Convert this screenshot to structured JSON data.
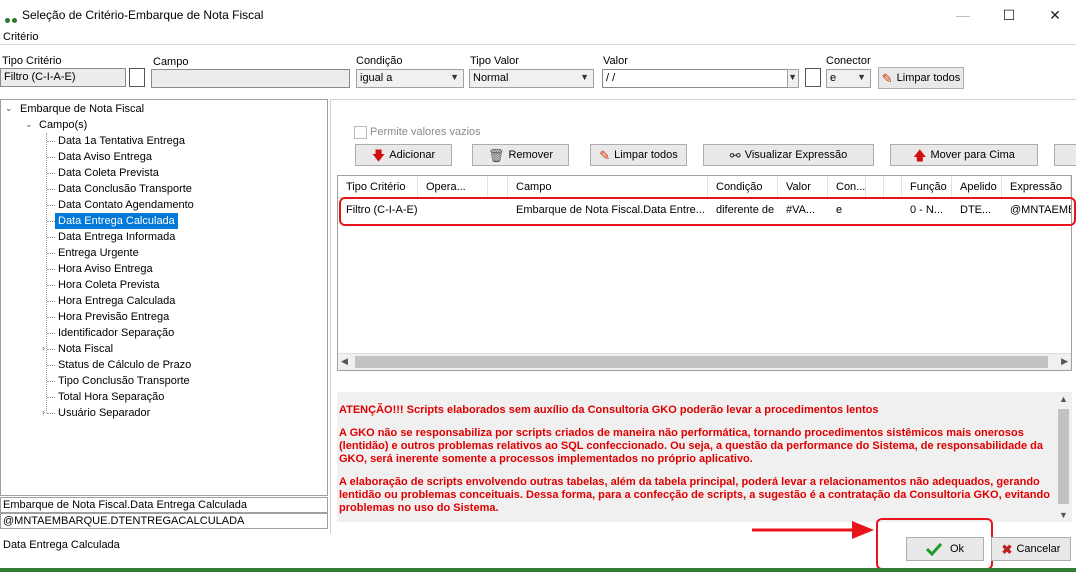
{
  "window": {
    "title": "Seleção de Critério-Embarque de Nota Fiscal",
    "minimize": "—",
    "maximize": "☐",
    "close": "✕"
  },
  "criterio": {
    "group_label": "Critério",
    "tipo_criterio_label": "Tipo Critério",
    "tipo_criterio_value": "Filtro (C-I-A-E)",
    "campo_label": "Campo",
    "campo_value": "",
    "condicao_label": "Condição",
    "condicao_value": "igual a",
    "tipo_valor_label": "Tipo Valor",
    "tipo_valor_value": "Normal",
    "valor_label": "Valor",
    "valor_value": " /  /",
    "conector_label": "Conector",
    "conector_value": "e",
    "limpar_todos_label": "Limpar todos"
  },
  "tree": {
    "root": "Embarque de Nota Fiscal",
    "campos": "Campo(s)",
    "items": [
      {
        "label": "Data 1a Tentativa Entrega",
        "expandable": false,
        "selected": false
      },
      {
        "label": "Data Aviso Entrega",
        "expandable": false,
        "selected": false
      },
      {
        "label": "Data Coleta Prevista",
        "expandable": false,
        "selected": false
      },
      {
        "label": "Data Conclusão Transporte",
        "expandable": false,
        "selected": false
      },
      {
        "label": "Data Contato Agendamento",
        "expandable": false,
        "selected": false
      },
      {
        "label": "Data Entrega Calculada",
        "expandable": false,
        "selected": true
      },
      {
        "label": "Data Entrega Informada",
        "expandable": false,
        "selected": false
      },
      {
        "label": "Entrega Urgente",
        "expandable": false,
        "selected": false
      },
      {
        "label": "Hora Aviso Entrega",
        "expandable": false,
        "selected": false
      },
      {
        "label": "Hora Coleta Prevista",
        "expandable": false,
        "selected": false
      },
      {
        "label": "Hora Entrega Calculada",
        "expandable": false,
        "selected": false
      },
      {
        "label": "Hora Previsão Entrega",
        "expandable": false,
        "selected": false
      },
      {
        "label": "Identificador Separação",
        "expandable": false,
        "selected": false
      },
      {
        "label": "Nota Fiscal",
        "expandable": true,
        "selected": false
      },
      {
        "label": "Status de Cálculo de Prazo",
        "expandable": false,
        "selected": false
      },
      {
        "label": "Tipo Conclusão Transporte",
        "expandable": false,
        "selected": false
      },
      {
        "label": "Total Hora Separação",
        "expandable": false,
        "selected": false
      },
      {
        "label": "Usuário Separador",
        "expandable": true,
        "selected": false
      }
    ]
  },
  "selected_path": "Embarque de Nota Fiscal.Data Entrega Calculada",
  "selected_expression": "@MNTAEMBARQUE.DTENTREGACALCULADA",
  "status_text": "Data Entrega Calculada",
  "permite_vazios_label": "Permite valores vazios",
  "toolbar": {
    "adicionar": "Adicionar",
    "remover": "Remover",
    "limpar_todos": "Limpar todos",
    "visualizar": "Visualizar Expressão",
    "mover_cima": "Mover para Cima"
  },
  "grid": {
    "columns": [
      "Tipo Critério",
      "Opera...",
      "",
      "Campo",
      "Condição",
      "Valor",
      "Con...",
      "",
      "",
      "Função",
      "Apelido",
      "Expressão"
    ],
    "rows": [
      [
        "Filtro (C-I-A-E)",
        "",
        "",
        "Embarque de Nota Fiscal.Data Entre...",
        "diferente de",
        "#VA...",
        "e",
        "",
        "",
        "0 - N...",
        "DTE...",
        "@MNTAEMBAR"
      ]
    ]
  },
  "warning": {
    "p1": "ATENÇÃO!!! Scripts elaborados sem auxílio da Consultoria GKO poderão levar a procedimentos lentos",
    "p2": "A GKO não se responsabiliza por scripts criados de maneira não performática, tornando procedimentos sistêmicos mais onerosos (lentidão) e outros problemas relativos ao SQL confeccionado. Ou seja, a questão da performance do Sistema, de responsabilidade da GKO, será inerente somente a processos implementados no próprio aplicativo.",
    "p3": "A elaboração de scripts envolvendo outras tabelas, além da tabela principal, poderá levar a relacionamentos não adequados, gerando lentidão ou problemas conceituais. Dessa forma, para a confecção de scripts, a sugestão é a contratação da Consultoria GKO, evitando problemas no uso do Sistema."
  },
  "footer": {
    "ok": "Ok",
    "cancelar": "Cancelar"
  },
  "colors": {
    "accent_selection": "#0078d7",
    "warning_text": "#e00000",
    "highlight_red": "#e8141b",
    "ok_check": "#1e9a2e",
    "cancel_x": "#c0201e"
  }
}
